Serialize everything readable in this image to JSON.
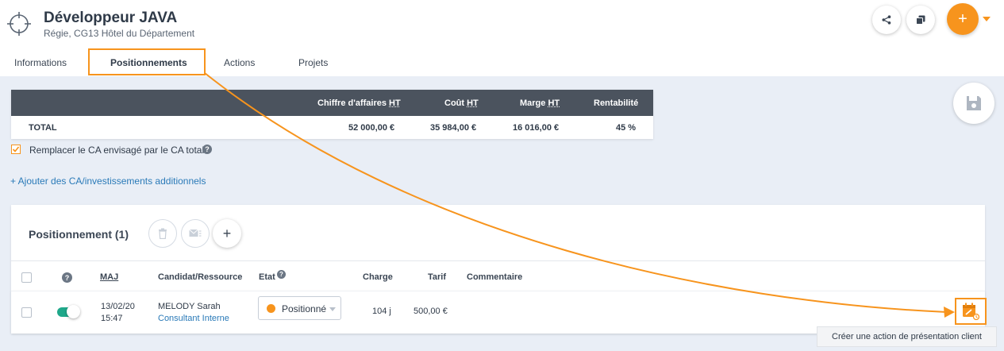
{
  "header": {
    "title": "Développeur JAVA",
    "subtitle": "Régie, CG13 Hôtel du Département",
    "add_button_label": "+"
  },
  "tabs": [
    {
      "label": "Informations",
      "active": false
    },
    {
      "label": "Positionnements",
      "active": true
    },
    {
      "label": "Actions",
      "active": false
    },
    {
      "label": "Projets",
      "active": false
    }
  ],
  "summary": {
    "headers": [
      "Chiffre d'affaires",
      "HT",
      "Coût",
      "Marge",
      "Rentabilité"
    ],
    "row_label": "TOTAL",
    "values": {
      "chiffre_affaires": "52 000,00 €",
      "cout": "35 984,00 €",
      "marge": "16 016,00 €",
      "rentabilite": "45 %"
    }
  },
  "replace_ca": {
    "label": "Remplacer le CA envisagé par le CA total",
    "checked": true,
    "help": "?"
  },
  "add_link": "+ Ajouter des CA/investissements additionnels",
  "positionnement": {
    "title": "Positionnement (1)",
    "add_label": "+",
    "columns": {
      "help": "?",
      "maj": "MAJ",
      "candidat": "Candidat/Ressource",
      "etat": "Etat",
      "charge": "Charge",
      "tarif": "Tarif",
      "commentaire": "Commentaire"
    },
    "rows": [
      {
        "date": "13/02/20",
        "time": "15:47",
        "name": "MELODY Sarah",
        "role": "Consultant Interne",
        "status": "Positionné",
        "charge": "104 j",
        "tarif": "500,00 €",
        "commentaire": ""
      }
    ]
  },
  "tooltip": "Créer une action de présentation client",
  "colors": {
    "accent": "#f7941d",
    "dark_header": "#4b535e",
    "toggle_on": "#1fa88a",
    "link": "#2a7ab8"
  }
}
